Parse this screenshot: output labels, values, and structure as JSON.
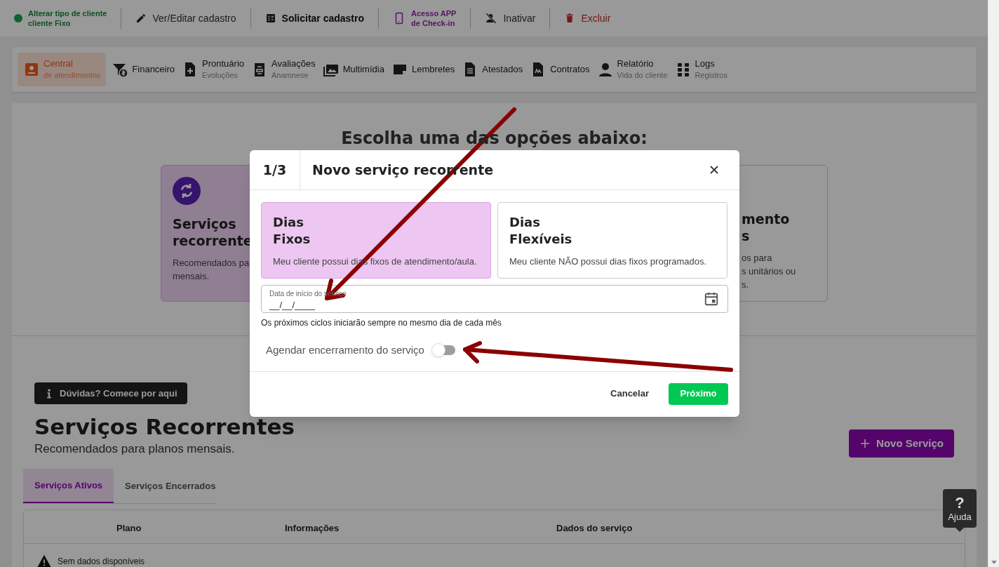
{
  "top_bar": {
    "items": [
      {
        "kind": "status",
        "lines": [
          "Alterar tipo de cliente",
          "cliente Fixo"
        ],
        "color": "#0d622c"
      },
      {
        "kind": "edit",
        "lines": [
          "Ver/Editar cadastro"
        ]
      },
      {
        "kind": "request",
        "lines": [
          "Solicitar cadastro"
        ]
      },
      {
        "kind": "app",
        "lines": [
          "Acesso APP",
          "de Check-in"
        ]
      },
      {
        "kind": "deactivate",
        "lines": [
          "Inativar"
        ]
      },
      {
        "kind": "delete",
        "lines": [
          "Excluir"
        ]
      }
    ]
  },
  "nav": {
    "items": [
      {
        "label": "Central",
        "sublabel": "de atendimentos",
        "selected": true
      },
      {
        "label": "Financeiro",
        "selected": false
      },
      {
        "label": "Prontuário",
        "sublabel": "Evoluções",
        "selected": false
      },
      {
        "label": "Avaliações",
        "sublabel": "Anamnese",
        "selected": false
      },
      {
        "label": "Multimídia",
        "selected": false
      },
      {
        "label": "Lembretes",
        "selected": false
      },
      {
        "label": "Atestados",
        "selected": false
      },
      {
        "label": "Contratos",
        "selected": false
      },
      {
        "label": "Relatório",
        "sublabel": "Vida do cliente",
        "selected": false
      },
      {
        "label": "Logs",
        "sublabel": "Registros",
        "selected": false
      }
    ]
  },
  "options": {
    "heading": "Escolha uma das opções abaixo:",
    "left_card": {
      "title_lines": [
        "Serviços",
        "recorrente"
      ],
      "description_lines": [
        "Recomendados pa",
        "mensais."
      ]
    },
    "right_card": {
      "title_lines": [
        "mento",
        "s"
      ],
      "description_lines": [
        "os para",
        "s unitários ou",
        "s."
      ]
    }
  },
  "help_link": "Dúvidas? Comece por aqui",
  "section": {
    "title": "Serviços Recorrentes",
    "subtitle": "Recomendados para planos mensais.",
    "new_button": "Novo Serviço"
  },
  "tabs": [
    {
      "label": "Serviços Ativos",
      "selected": true
    },
    {
      "label": "Serviços Encerrados",
      "selected": false
    }
  ],
  "table": {
    "columns": [
      "Plano",
      "Informações",
      "Dados do serviço"
    ],
    "empty_message": "Sem dados disponíveis"
  },
  "modal": {
    "step": "1/3",
    "title": "Novo serviço recorrente",
    "choices": [
      {
        "title_lines": [
          "Dias",
          "Fixos"
        ],
        "description": "Meu cliente possui dias fixos de atendimento/aula.",
        "selected": true
      },
      {
        "title_lines": [
          "Dias",
          "Flexíveis"
        ],
        "description": "Meu cliente NÃO possui dias fixos programados.",
        "selected": false
      }
    ],
    "date_field": {
      "label": "Data de início do serviço",
      "value": "__/__/____"
    },
    "hint": "Os próximos ciclos iniciarão sempre no mesmo dia de cada mês",
    "end_toggle": {
      "label": "Agendar encerramento do serviço",
      "on": false
    },
    "buttons": {
      "cancel": "Cancelar",
      "next": "Próximo"
    }
  },
  "help_button": {
    "symbol": "?",
    "label": "Ajuda"
  }
}
